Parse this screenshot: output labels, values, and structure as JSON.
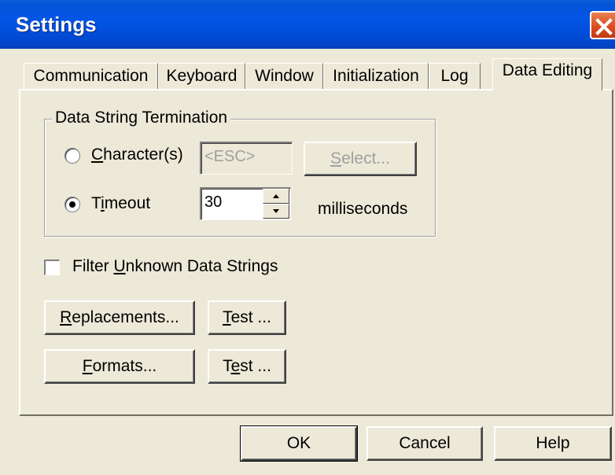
{
  "window": {
    "title": "Settings"
  },
  "tabs": [
    {
      "label": "Communication",
      "active": false
    },
    {
      "label": "Keyboard",
      "active": false
    },
    {
      "label": "Window",
      "active": false
    },
    {
      "label": "Initialization",
      "active": false
    },
    {
      "label": "Log",
      "active": false
    },
    {
      "label": "Data Editing",
      "active": true
    }
  ],
  "group": {
    "title": "Data String Termination",
    "characters": {
      "pre": "",
      "u": "C",
      "post": "haracter(s)",
      "selected": false,
      "value": "<ESC>",
      "enabled": false
    },
    "select_button": {
      "pre": "",
      "u": "S",
      "post": "elect...",
      "enabled": false
    },
    "timeout": {
      "pre": "T",
      "u": "i",
      "post": "meout",
      "selected": true,
      "value": "30",
      "unit": "milliseconds"
    }
  },
  "filter": {
    "pre": "Filter ",
    "u": "U",
    "post": "nknown Data Strings",
    "checked": false
  },
  "buttons": {
    "replacements": {
      "pre": "",
      "u": "R",
      "post": "eplacements..."
    },
    "test1": {
      "pre": "",
      "u": "T",
      "post": "est ..."
    },
    "formats": {
      "pre": "",
      "u": "F",
      "post": "ormats..."
    },
    "test2": {
      "pre": "T",
      "u": "e",
      "post": "st ..."
    }
  },
  "footer": {
    "ok": "OK",
    "cancel": "Cancel",
    "help": "Help"
  },
  "colors": {
    "titlebar": "#0355e6",
    "close": "#d94a1e",
    "face": "#ece9d8"
  },
  "icons": {
    "close": "close-icon",
    "spin_up": "arrow-up-icon",
    "spin_down": "arrow-down-icon"
  }
}
